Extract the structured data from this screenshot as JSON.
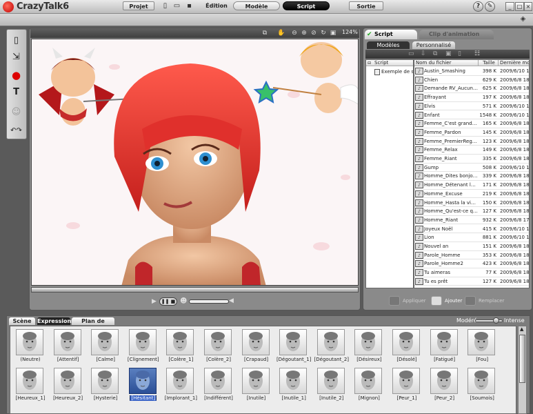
{
  "app": {
    "name": "CrazyTalk6"
  },
  "title_buttons": {
    "help": "?",
    "minimize": "_",
    "maximize": "□",
    "close": "×"
  },
  "nav": {
    "projet": "Projet",
    "edition": "Édition",
    "modele": "Modèle",
    "script": "Script",
    "sortie": "Sortie"
  },
  "viewport": {
    "zoom": "124%"
  },
  "right_panel": {
    "tabs": [
      "Script",
      "Clip d'animation"
    ],
    "subtabs": [
      "Modèles",
      "Personnalisé"
    ],
    "tree": {
      "header": "Script",
      "item": "Exemple de script"
    },
    "columns": {
      "name": "Nom du fichier",
      "size": "Taille",
      "date": "Dernière mo"
    },
    "files": [
      {
        "name": "Austin_Smashing",
        "size": "398 K",
        "date": "2009/6/10 1"
      },
      {
        "name": "Chien",
        "size": "629 K",
        "date": "2009/6/8 18"
      },
      {
        "name": "Demande RV_Aucune e...",
        "size": "625 K",
        "date": "2009/6/8 18"
      },
      {
        "name": "Effrayant",
        "size": "197 K",
        "date": "2009/6/8 18"
      },
      {
        "name": "Elvis",
        "size": "571 K",
        "date": "2009/6/10 1"
      },
      {
        "name": "Enfant",
        "size": "1548 K",
        "date": "2009/6/10 1"
      },
      {
        "name": "Femme_C'est grandiose !",
        "size": "165 K",
        "date": "2009/6/8 18"
      },
      {
        "name": "Femme_Pardon",
        "size": "145 K",
        "date": "2009/6/8 18"
      },
      {
        "name": "Femme_PremierRegard",
        "size": "123 K",
        "date": "2009/6/8 18"
      },
      {
        "name": "Femme_Relax",
        "size": "149 K",
        "date": "2009/6/8 18"
      },
      {
        "name": "Femme_Riant",
        "size": "335 K",
        "date": "2009/6/8 18"
      },
      {
        "name": "Gump",
        "size": "508 K",
        "date": "2009/6/10 1"
      },
      {
        "name": "Homme_Dites bonjour ...",
        "size": "339 K",
        "date": "2009/6/8 18"
      },
      {
        "name": "Homme_Détenant la vé...",
        "size": "171 K",
        "date": "2009/6/8 18"
      },
      {
        "name": "Homme_Excuse",
        "size": "219 K",
        "date": "2009/6/8 18"
      },
      {
        "name": "Homme_Hasta la vista",
        "size": "150 K",
        "date": "2009/6/8 18"
      },
      {
        "name": "Homme_Qu'est-ce que ...",
        "size": "127 K",
        "date": "2009/6/8 18"
      },
      {
        "name": "Homme_Riant",
        "size": "932 K",
        "date": "2009/6/8 17"
      },
      {
        "name": "Joyeux Noël",
        "size": "415 K",
        "date": "2009/6/10 1"
      },
      {
        "name": "Lion",
        "size": "881 K",
        "date": "2009/6/10 1"
      },
      {
        "name": "Nouvel an",
        "size": "151 K",
        "date": "2009/6/8 18"
      },
      {
        "name": "Parole_Homme",
        "size": "353 K",
        "date": "2009/6/8 18"
      },
      {
        "name": "Parole_Homme2",
        "size": "423 K",
        "date": "2009/6/8 18"
      },
      {
        "name": "Tu aimeras",
        "size": "77 K",
        "date": "2009/6/8 18"
      },
      {
        "name": "Tu es prêt",
        "size": "127 K",
        "date": "2009/6/8 18"
      }
    ],
    "buttons": {
      "apply": "Appliquer",
      "add": "Ajouter",
      "replace": "Remplacer"
    }
  },
  "bottom": {
    "tabs": [
      "Scène",
      "Expressions",
      "Plan de montage"
    ],
    "slider": {
      "min_label": "Modéré",
      "max_label": "Intense",
      "level": 0.75
    },
    "expressions": [
      "(Neutre)",
      "[Attentif]",
      "[Calme]",
      "[Clignement]",
      "[Colère_1]",
      "[Colère_2]",
      "[Crapaud]",
      "[Dégoutant_1]",
      "[Dégoutant_2]",
      "[Désireux]",
      "[Désolé]",
      "[Fatigué]",
      "[Fou]",
      "[Heureux_1]",
      "[Heureux_2]",
      "[Hysterie]",
      "[Hésitant]",
      "[Implorant_1]",
      "[Indifférent]",
      "[Inutile]",
      "[Inutile_1]",
      "[Inutile_2]",
      "[Mignon]",
      "[Peur_1]",
      "[Peur_2]",
      "[Soumois]"
    ],
    "selected": "[Hésitant]"
  },
  "colors": {
    "accent": "#3a64c8",
    "hair": "#e8312f"
  }
}
